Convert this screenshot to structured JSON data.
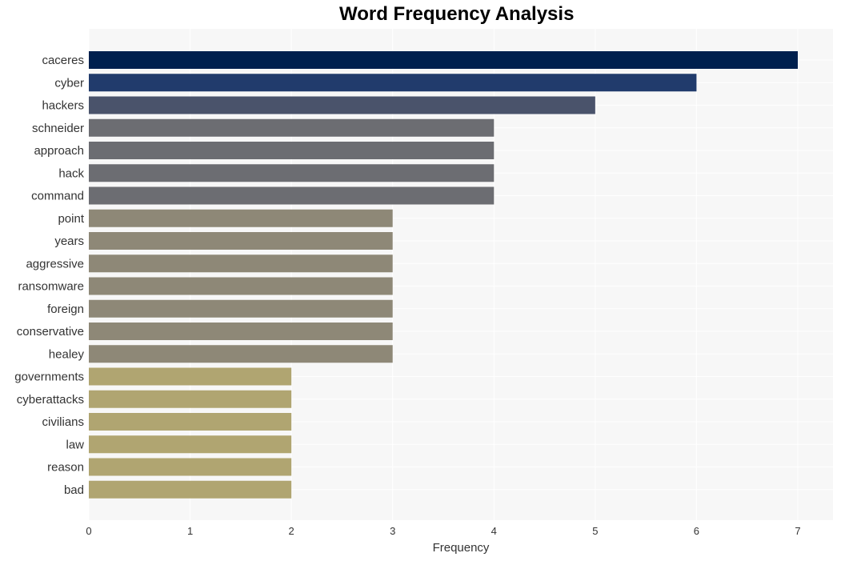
{
  "chart_data": {
    "type": "bar",
    "orientation": "horizontal",
    "title": "Word Frequency Analysis",
    "xlabel": "Frequency",
    "ylabel": "",
    "xlim": [
      0,
      7.35
    ],
    "xticks": [
      0,
      1,
      2,
      3,
      4,
      5,
      6,
      7
    ],
    "grid": true,
    "categories": [
      "caceres",
      "cyber",
      "hackers",
      "schneider",
      "approach",
      "hack",
      "command",
      "point",
      "years",
      "aggressive",
      "ransomware",
      "foreign",
      "conservative",
      "healey",
      "governments",
      "cyberattacks",
      "civilians",
      "law",
      "reason",
      "bad"
    ],
    "values": [
      7,
      6,
      5,
      4,
      4,
      4,
      4,
      3,
      3,
      3,
      3,
      3,
      3,
      3,
      2,
      2,
      2,
      2,
      2,
      2
    ],
    "colors": [
      "#00204e",
      "#213b6c",
      "#4a536b",
      "#6c6d72",
      "#6c6d72",
      "#6c6d72",
      "#6c6d72",
      "#8e8877",
      "#8e8877",
      "#8e8877",
      "#8e8877",
      "#8e8877",
      "#8e8877",
      "#8e8877",
      "#b0a571",
      "#b0a571",
      "#b0a571",
      "#b0a571",
      "#b0a571",
      "#b0a571"
    ],
    "background": "#f7f7f7",
    "grid_color": "#ffffff"
  }
}
